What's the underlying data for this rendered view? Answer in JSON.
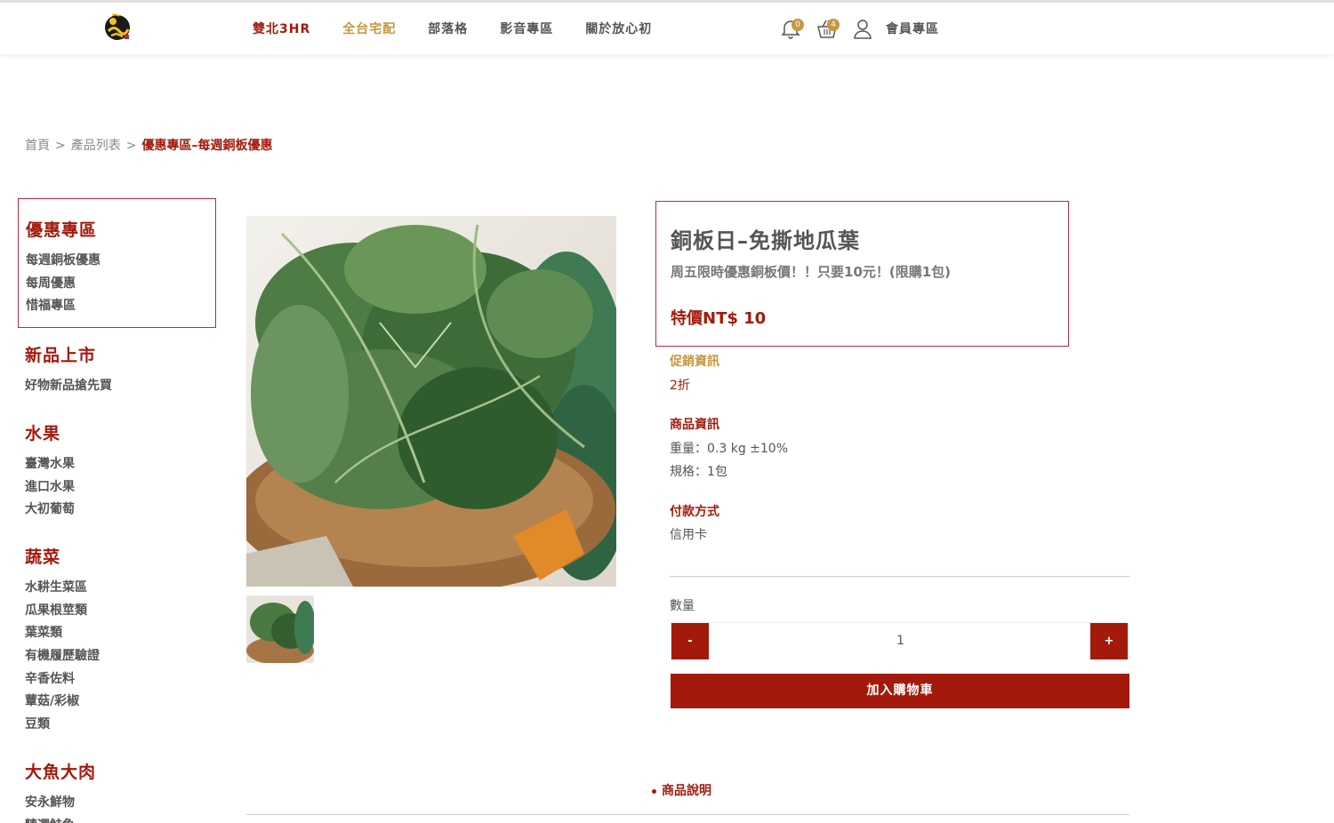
{
  "header": {
    "nav": [
      {
        "label": "雙北3HR",
        "style": "red"
      },
      {
        "label": "全台宅配",
        "style": "gold"
      },
      {
        "label": "部落格",
        "style": "normal"
      },
      {
        "label": "影音專區",
        "style": "normal"
      },
      {
        "label": "關於放心初",
        "style": "normal"
      }
    ],
    "notification_count": "0",
    "cart_count": "4",
    "member_label": "會員專區",
    "icons": [
      "logo-icon",
      "bell-icon",
      "basket-icon",
      "user-icon"
    ]
  },
  "breadcrumb": {
    "items": [
      "首頁",
      "產品列表"
    ],
    "separator": ">",
    "current": "優惠專區–每週銅板優惠"
  },
  "sidebar": {
    "featured": {
      "title": "優惠專區",
      "links": [
        "每週銅板優惠",
        "每周優惠",
        "惜福專區"
      ]
    },
    "groups": [
      {
        "title": "新品上市",
        "links": [
          "好物新品搶先買"
        ]
      },
      {
        "title": "水果",
        "links": [
          "臺灣水果",
          "進口水果",
          "大初葡萄"
        ]
      },
      {
        "title": "蔬菜",
        "links": [
          "水耕生菜區",
          "瓜果根莖類",
          "葉菜類",
          "有機履歷驗證",
          "辛香佐料",
          "蕈菇/彩椒",
          "豆類"
        ]
      },
      {
        "title": "大魚大肉",
        "links": [
          "安永鮮物",
          "精選鮭魚"
        ]
      }
    ]
  },
  "product": {
    "title": "銅板日–免撕地瓜葉",
    "subtitle": "周五限時優惠銅板價！！只要10元！(限購1包)",
    "price": "特價NT$ 10",
    "promo_heading": "促銷資訊",
    "promo_value": "2折",
    "info_heading": "商品資訊",
    "weight": "重量：0.3 kg ±10%",
    "spec": "規格：1包",
    "payment_heading": "付款方式",
    "payment_value": "信用卡",
    "qty_label": "數量",
    "qty_value": "1",
    "minus_label": "-",
    "plus_label": "+",
    "add_to_cart": "加入購物車",
    "description_tab": "商品說明"
  },
  "colors": {
    "brand_red": "#a31a0c",
    "gold": "#c8963c",
    "box_border": "#c0283e"
  }
}
